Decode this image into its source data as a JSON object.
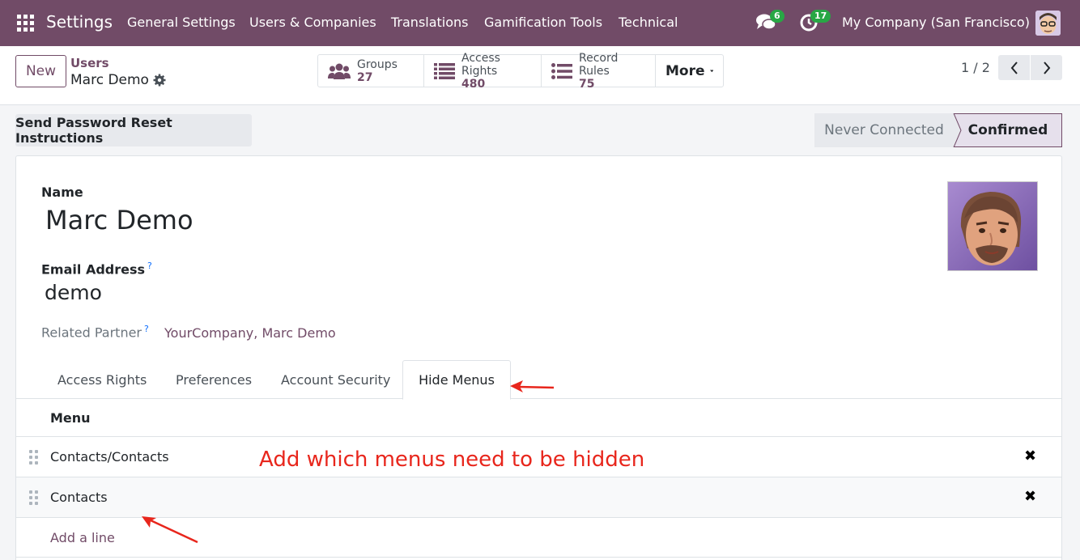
{
  "topnav": {
    "brand": "Settings",
    "menu": [
      "General Settings",
      "Users & Companies",
      "Translations",
      "Gamification Tools",
      "Technical"
    ],
    "messages_count": "6",
    "activities_count": "17",
    "company": "My Company (San Francisco)"
  },
  "control_panel": {
    "new_label": "New",
    "breadcrumb_parent": "Users",
    "breadcrumb_current": "Marc Demo",
    "stats": [
      {
        "label": "Groups",
        "value": "27",
        "icon": "users-icon"
      },
      {
        "label": "Access Rights",
        "value": "480",
        "icon": "list-icon"
      },
      {
        "label": "Record Rules",
        "value": "75",
        "icon": "list-icon"
      }
    ],
    "more_label": "More",
    "pager": "1 / 2"
  },
  "actions": {
    "reset_password": "Send Password Reset Instructions"
  },
  "statusbar": {
    "states": [
      "Never Connected",
      "Confirmed"
    ],
    "active": "Confirmed"
  },
  "form": {
    "name_label": "Name",
    "name_value": "Marc Demo",
    "email_label": "Email Address",
    "email_value": "demo",
    "help_mark": "?",
    "partner_label": "Related Partner",
    "partner_value": "YourCompany, Marc Demo"
  },
  "tabs": {
    "items": [
      "Access Rights",
      "Preferences",
      "Account Security",
      "Hide Menus"
    ],
    "active": "Hide Menus"
  },
  "hide_menus": {
    "column_header": "Menu",
    "rows": [
      "Contacts/Contacts",
      "Contacts"
    ],
    "add_line": "Add a line"
  },
  "annotation": {
    "text": "Add which menus need to be hidden",
    "color": "#e8261c"
  },
  "colors": {
    "brand": "#714b67",
    "badge": "#28a745"
  }
}
